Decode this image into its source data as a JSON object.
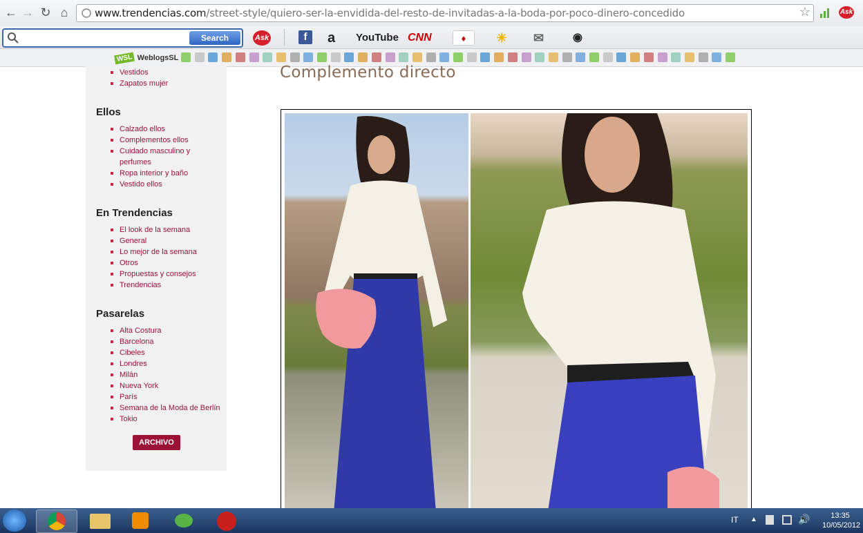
{
  "browser": {
    "url_domain": "www.trendencias.com",
    "url_path": "/street-style/quiero-ser-la-envidida-del-resto-de-invitadas-a-la-boda-por-poco-dinero-concedido",
    "back_icon": "back-arrow-icon",
    "forward_icon": "forward-arrow-icon",
    "reload_icon": "reload-icon",
    "home_icon": "home-icon",
    "star_icon": "star-icon"
  },
  "ask_toolbar": {
    "search_button": "Search",
    "ask_logo": "Ask",
    "youtube_label": "YouTube",
    "cnn_label": "CNN"
  },
  "bookmarks": {
    "weblogs_label": "WeblogsSL",
    "weblogs_badge": "WSL"
  },
  "sidebar": {
    "top_items": [
      "Vestidos",
      "Zapatos mujer"
    ],
    "sections": [
      {
        "title": "Ellos",
        "items": [
          "Calzado ellos",
          "Complementos ellos",
          "Cuidado masculino y perfumes",
          "Ropa interior y baño",
          "Vestido ellos"
        ]
      },
      {
        "title": "En Trendencias",
        "items": [
          "El look de la semana",
          "General",
          "Lo mejor de la semana",
          "Otros",
          "Propuestas y consejos",
          "Trendencias"
        ]
      },
      {
        "title": "Pasarelas",
        "items": [
          "Alta Costura",
          "Barcelona",
          "Cibeles",
          "Londres",
          "Milán",
          "Nueva York",
          "París",
          "Semana de la Moda de Berlín",
          "Tokio"
        ]
      }
    ],
    "archive_button": "ARCHIVO"
  },
  "article": {
    "title": "Complemento directo"
  },
  "taskbar": {
    "language": "IT",
    "time": "13:35",
    "date": "10/05/2012"
  },
  "colors": {
    "link": "#9c1237",
    "title": "#8a6a55",
    "sidebar_bg": "#f2f2f2"
  }
}
